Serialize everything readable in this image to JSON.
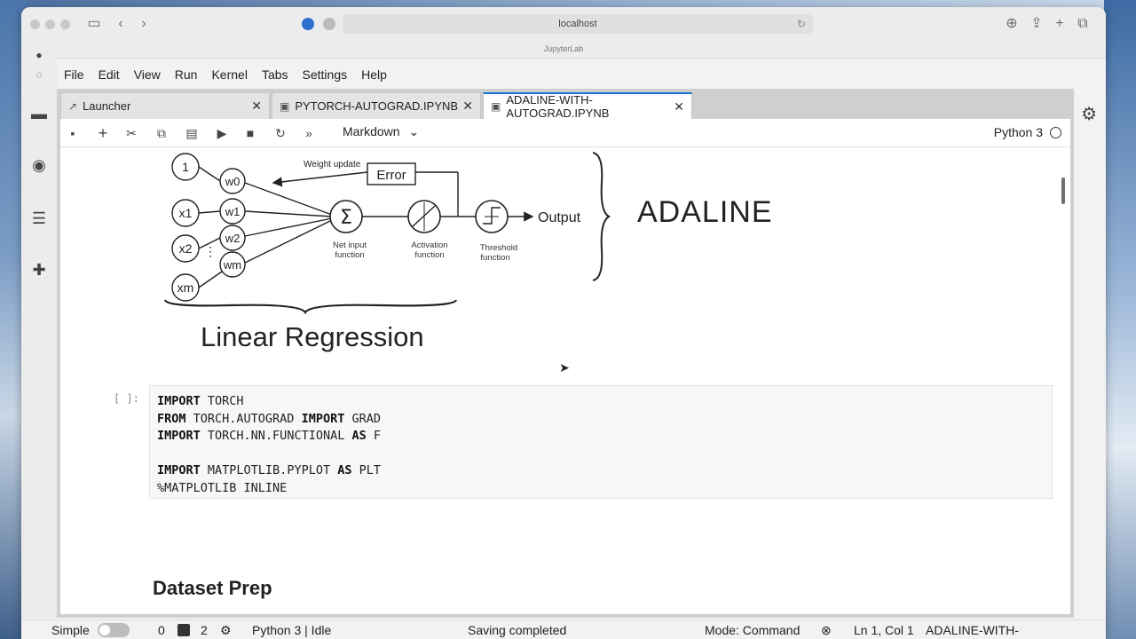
{
  "browser": {
    "url": "localhost",
    "page_title": "JupyterLab"
  },
  "menu": [
    "File",
    "Edit",
    "View",
    "Run",
    "Kernel",
    "Tabs",
    "Settings",
    "Help"
  ],
  "tabs": [
    {
      "label": "Launcher",
      "icon": "launcher-icon",
      "active": false
    },
    {
      "label": "PYTORCH-AUTOGRAD.IPYNB",
      "icon": "notebook-icon",
      "active": false
    },
    {
      "label": "ADALINE-WITH-AUTOGRAD.IPYNB",
      "icon": "notebook-icon",
      "active": true
    }
  ],
  "toolbar": {
    "cell_type": "Markdown",
    "kernel_name": "Python 3"
  },
  "diagram": {
    "inputs": [
      "1",
      "x1",
      "x2",
      "xm"
    ],
    "weights": [
      "w0",
      "w1",
      "w2",
      "wm"
    ],
    "weight_update": "Weight update",
    "error": "Error",
    "net_input": [
      "Net input",
      "function"
    ],
    "activation": [
      "Activation",
      "function"
    ],
    "threshold": [
      "Threshold",
      "function"
    ],
    "output": "Output",
    "sigma": "Σ"
  },
  "adaline_label": "ADALINE",
  "linear_regression_label": "Linear Regression",
  "code_cell": {
    "prompt": "[ ]:",
    "lines": [
      [
        {
          "t": "IMPORT",
          "kw": true
        },
        {
          "t": " TORCH",
          "kw": false
        }
      ],
      [
        {
          "t": "FROM",
          "kw": true
        },
        {
          "t": " TORCH.AUTOGRAD ",
          "kw": false
        },
        {
          "t": "IMPORT",
          "kw": true
        },
        {
          "t": " GRAD",
          "kw": false
        }
      ],
      [
        {
          "t": "IMPORT",
          "kw": true
        },
        {
          "t": " TORCH.NN.FUNCTIONAL ",
          "kw": false
        },
        {
          "t": "AS",
          "kw": true
        },
        {
          "t": " F",
          "kw": false
        }
      ],
      [
        {
          "t": "",
          "kw": false
        }
      ],
      [
        {
          "t": "IMPORT",
          "kw": true
        },
        {
          "t": " MATPLOTLIB.PYPLOT ",
          "kw": false
        },
        {
          "t": "AS",
          "kw": true
        },
        {
          "t": " PLT",
          "kw": false
        }
      ],
      [
        {
          "t": "%MATPLOTLIB INLINE",
          "kw": false
        }
      ]
    ]
  },
  "section_heading": "Dataset Prep",
  "statusbar": {
    "mode_label": "Simple",
    "count_a": "0",
    "count_b": "2",
    "kernel_status": "Python 3 | Idle",
    "save_status": "Saving completed",
    "mode": "Mode: Command",
    "position": "Ln 1, Col 1",
    "filename": "ADALINE-WITH-AUTOGRAD.IPYNB"
  }
}
